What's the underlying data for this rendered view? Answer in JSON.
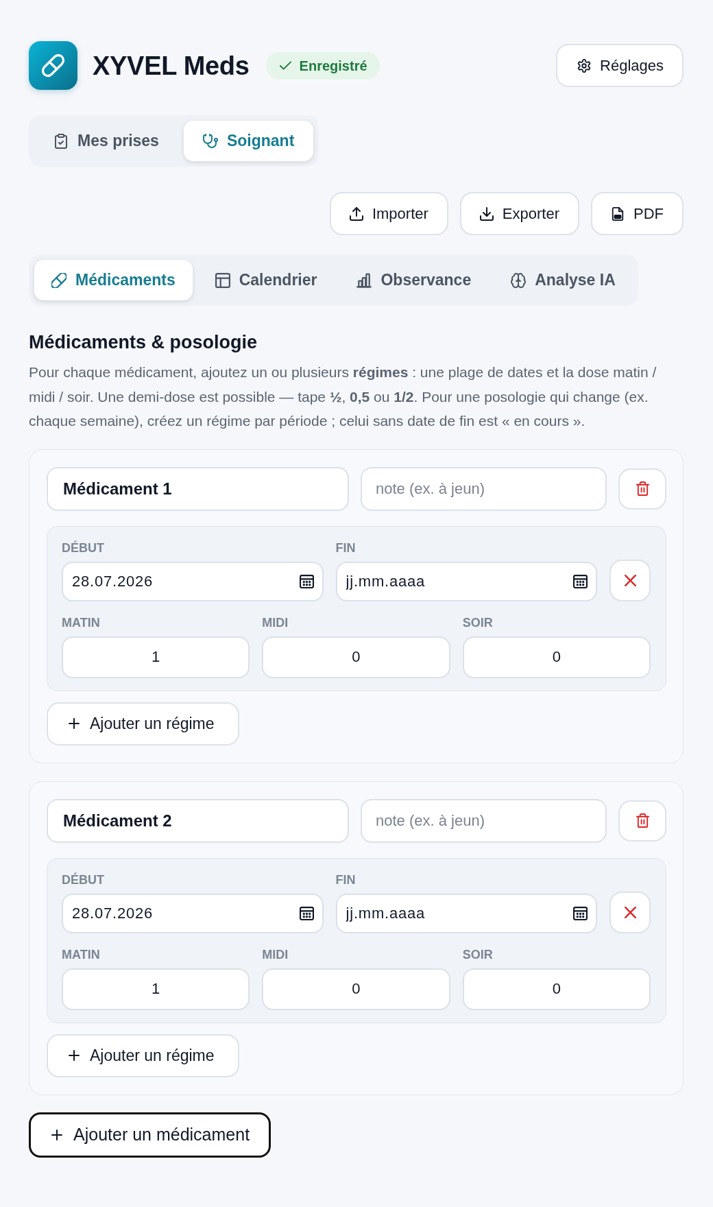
{
  "app": {
    "title": "XYVEL Meds",
    "save_status": "Enregistré",
    "settings_button": "Réglages"
  },
  "mode_tabs": [
    {
      "label": "Mes prises",
      "kind": "patient",
      "selected": false
    },
    {
      "label": "Soignant",
      "kind": "caregiver",
      "selected": true
    }
  ],
  "actions": [
    {
      "label": "Importer",
      "kind": "import"
    },
    {
      "label": "Exporter",
      "kind": "export"
    },
    {
      "label": "PDF",
      "kind": "pdf"
    }
  ],
  "section_tabs": [
    {
      "label": "Médicaments",
      "kind": "medications",
      "selected": true
    },
    {
      "label": "Calendrier",
      "kind": "calendar",
      "selected": false
    },
    {
      "label": "Observance",
      "kind": "adherence",
      "selected": false
    },
    {
      "label": "Analyse IA",
      "kind": "analysis",
      "selected": false
    }
  ],
  "section": {
    "title": "Médicaments & posologie",
    "description": "Pour chaque médicament, ajoutez un ou plusieurs **régimes** : une plage de dates et la dose matin / midi / soir. Une demi-dose est possible — tape **½**, **0,5** ou **1/2**. Pour une posologie qui change (ex. chaque semaine), créez un régime par période ; celui sans date de fin est « en cours »."
  },
  "medications": [
    {
      "name": "Médicament 1",
      "note": {
        "placeholder": "note (ex. à jeun)"
      },
      "regimens": [
        {
          "start": {
            "label": "DÉBUT",
            "value": "28.07.2026"
          },
          "end": {
            "label": "FIN",
            "placeholder": "jj.mm.aaaa"
          },
          "doses": [
            {
              "label": "MATIN",
              "value": "1"
            },
            {
              "label": "MIDI",
              "value": "0"
            },
            {
              "label": "SOIR",
              "value": "0"
            }
          ]
        }
      ],
      "add_regimen_button": "Ajouter un régime"
    },
    {
      "name": "Médicament 2",
      "note": {
        "placeholder": "note (ex. à jeun)"
      },
      "regimens": [
        {
          "start": {
            "label": "DÉBUT",
            "value": "28.07.2026"
          },
          "end": {
            "label": "FIN",
            "placeholder": "jj.mm.aaaa"
          },
          "doses": [
            {
              "label": "MATIN",
              "value": "1"
            },
            {
              "label": "MIDI",
              "value": "0"
            },
            {
              "label": "SOIR",
              "value": "0"
            }
          ]
        }
      ],
      "add_regimen_button": "Ajouter un régime"
    }
  ],
  "add_medication_button": "Ajouter un médicament"
}
